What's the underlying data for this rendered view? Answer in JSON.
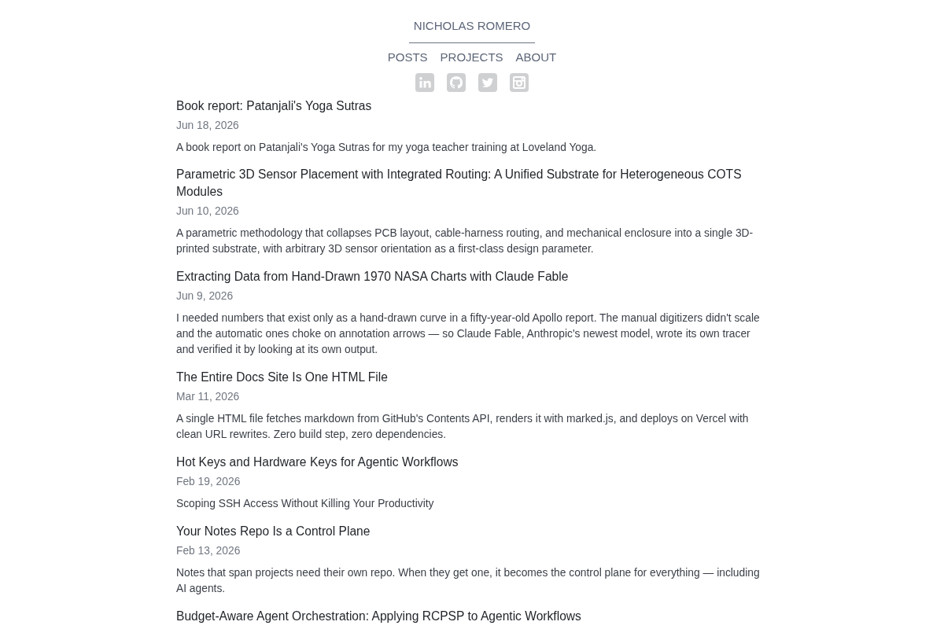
{
  "site": {
    "name": "NICHOLAS ROMERO"
  },
  "nav": [
    {
      "label": "POSTS"
    },
    {
      "label": "PROJECTS"
    },
    {
      "label": "ABOUT"
    }
  ],
  "posts": [
    {
      "title": "Book report: Patanjali's Yoga Sutras",
      "date": "Jun 18, 2026",
      "summary": "A book report on Patanjali's Yoga Sutras for my yoga teacher training at Loveland Yoga."
    },
    {
      "title": "Parametric 3D Sensor Placement with Integrated Routing: A Unified Substrate for Heterogeneous COTS Modules",
      "date": "Jun 10, 2026",
      "summary": "A parametric methodology that collapses PCB layout, cable-harness routing, and mechanical enclosure into a single 3D-printed substrate, with arbitrary 3D sensor orientation as a first-class design parameter."
    },
    {
      "title": "Extracting Data from Hand-Drawn 1970 NASA Charts with Claude Fable",
      "date": "Jun 9, 2026",
      "summary": "I needed numbers that exist only as a hand-drawn curve in a fifty-year-old Apollo report. The manual digitizers didn't scale and the automatic ones choke on annotation arrows — so Claude Fable, Anthropic's newest model, wrote its own tracer and verified it by looking at its own output."
    },
    {
      "title": "The Entire Docs Site Is One HTML File",
      "date": "Mar 11, 2026",
      "summary": "A single HTML file fetches markdown from GitHub's Contents API, renders it with marked.js, and deploys on Vercel with clean URL rewrites. Zero build step, zero dependencies."
    },
    {
      "title": "Hot Keys and Hardware Keys for Agentic Workflows",
      "date": "Feb 19, 2026",
      "summary": "Scoping SSH Access Without Killing Your Productivity"
    },
    {
      "title": "Your Notes Repo Is a Control Plane",
      "date": "Feb 13, 2026",
      "summary": "Notes that span projects need their own repo. When they get one, it becomes the control plane for everything — including AI agents."
    },
    {
      "title": "Budget-Aware Agent Orchestration: Applying RCPSP to Agentic Workflows"
    }
  ]
}
